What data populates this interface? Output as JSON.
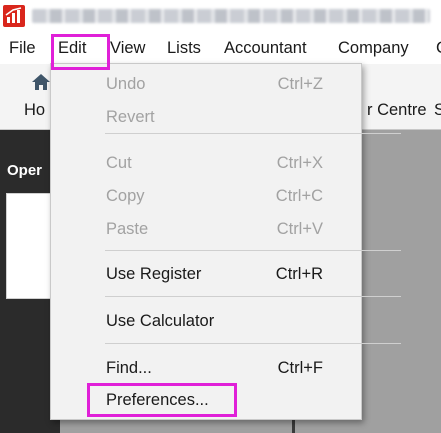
{
  "window": {
    "title": "",
    "icon": "app-logo-icon",
    "accent_color": "#d9261c"
  },
  "menubar": {
    "items": [
      {
        "label": "File"
      },
      {
        "label": "Edit"
      },
      {
        "label": "View"
      },
      {
        "label": "Lists"
      },
      {
        "label": "Accountant"
      },
      {
        "label": "Company"
      },
      {
        "label": "C"
      }
    ],
    "highlight_color": "#e020d8"
  },
  "toolbar": {
    "home_label": "Ho",
    "centre_label": "r Centre",
    "next_label": "S",
    "home_icon": "home-icon"
  },
  "side_panel": {
    "title": "Oper"
  },
  "edit_menu": {
    "items": [
      {
        "label": "Undo",
        "shortcut": "Ctrl+Z",
        "enabled": false
      },
      {
        "label": "Revert",
        "shortcut": "",
        "enabled": false
      },
      {
        "label": "Cut",
        "shortcut": "Ctrl+X",
        "enabled": false
      },
      {
        "label": "Copy",
        "shortcut": "Ctrl+C",
        "enabled": false
      },
      {
        "label": "Paste",
        "shortcut": "Ctrl+V",
        "enabled": false
      },
      {
        "label": "Use Register",
        "shortcut": "Ctrl+R",
        "enabled": true
      },
      {
        "label": "Use Calculator",
        "shortcut": "",
        "enabled": true
      },
      {
        "label": "Find...",
        "shortcut": "Ctrl+F",
        "enabled": true
      },
      {
        "label": "Preferences...",
        "shortcut": "",
        "enabled": true
      }
    ]
  }
}
